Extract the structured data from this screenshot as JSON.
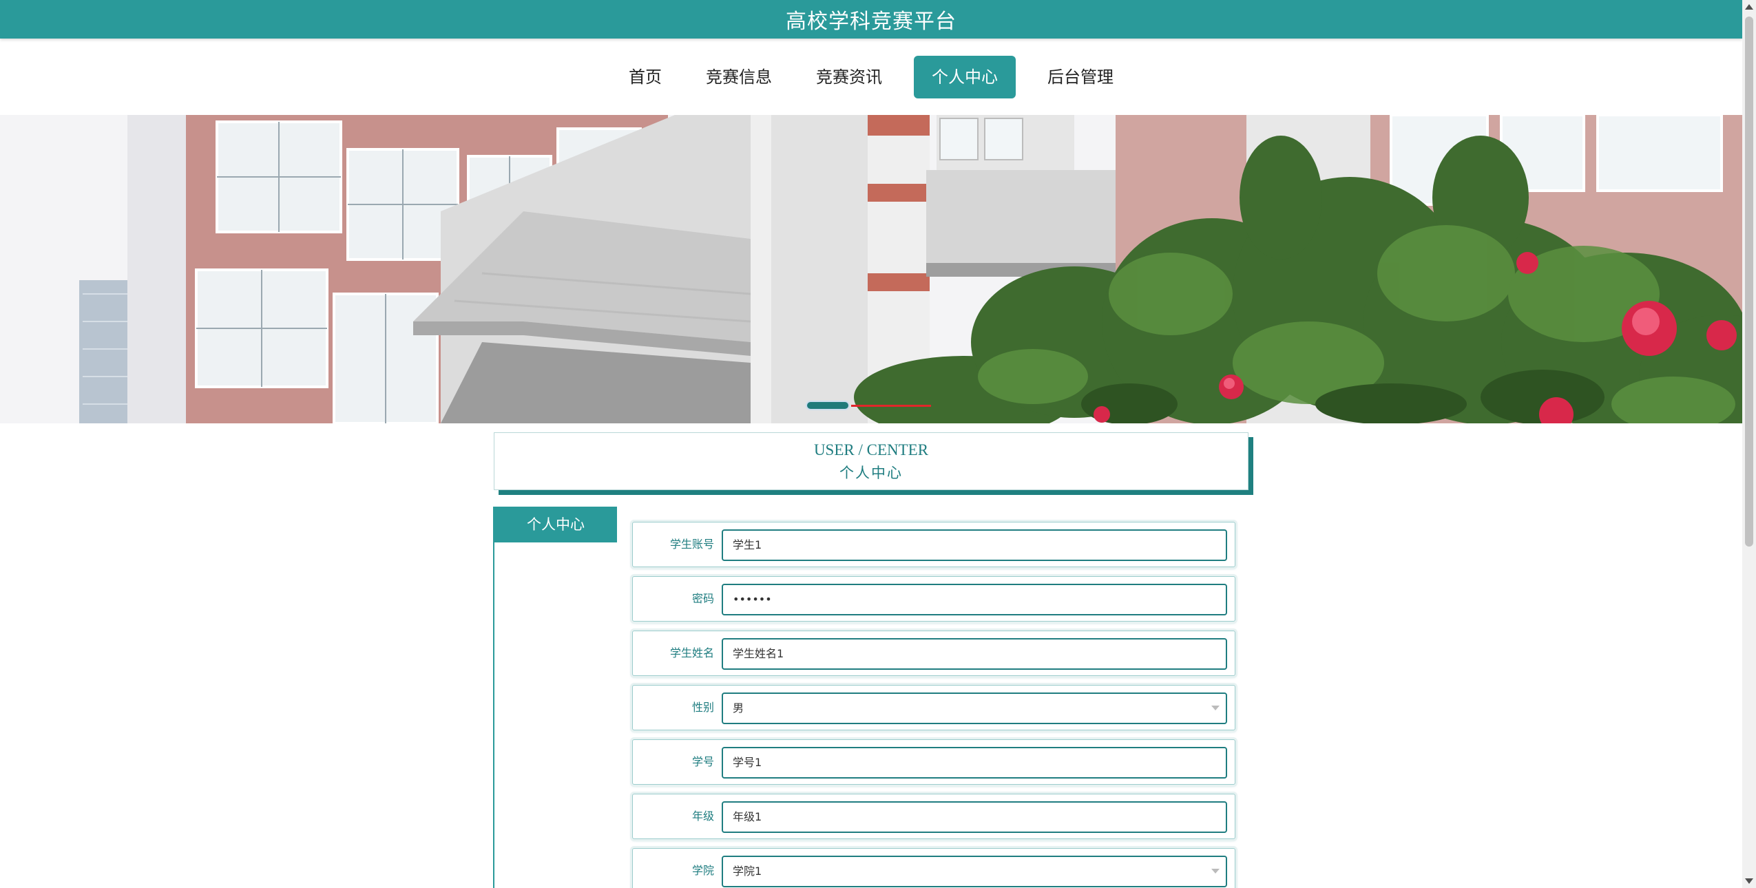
{
  "header": {
    "title": "高校学科竞赛平台"
  },
  "nav": {
    "items": [
      {
        "label": "首页",
        "active": false
      },
      {
        "label": "竞赛信息",
        "active": false
      },
      {
        "label": "竞赛资讯",
        "active": false
      },
      {
        "label": "个人中心",
        "active": true
      },
      {
        "label": "后台管理",
        "active": false
      }
    ]
  },
  "banner": {
    "image": "campus-building-with-camellia-flowers",
    "active_slide": 1
  },
  "section": {
    "title_en": "USER / CENTER",
    "title_cn": "个人中心"
  },
  "sidebar": {
    "title": "个人中心"
  },
  "form": {
    "fields": [
      {
        "label": "学生账号",
        "value": "学生1",
        "type": "text"
      },
      {
        "label": "密码",
        "value": "••••••",
        "type": "password"
      },
      {
        "label": "学生姓名",
        "value": "学生姓名1",
        "type": "text"
      },
      {
        "label": "性别",
        "value": "男",
        "type": "select"
      },
      {
        "label": "学号",
        "value": "学号1",
        "type": "text"
      },
      {
        "label": "年级",
        "value": "年级1",
        "type": "text"
      },
      {
        "label": "学院",
        "value": "学院1",
        "type": "select"
      }
    ]
  },
  "colors": {
    "primary": "#2a9a9a",
    "primary_dark": "#1f7d80",
    "indicator": "#e1262a"
  }
}
